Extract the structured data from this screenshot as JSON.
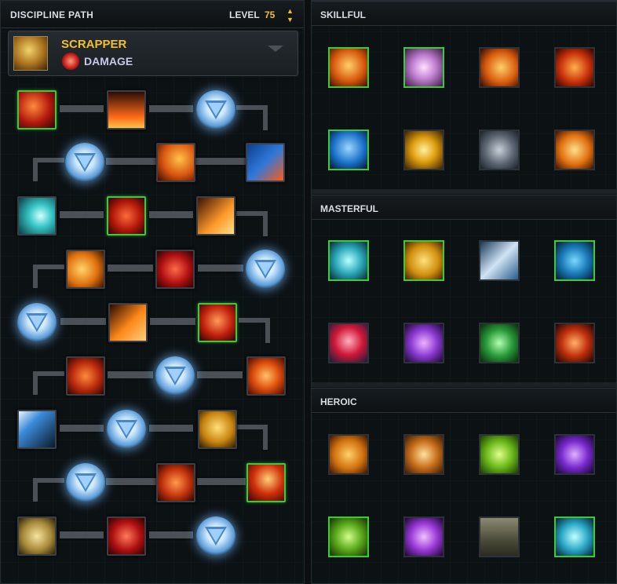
{
  "left": {
    "title": "DISCIPLINE PATH",
    "level_label": "LEVEL",
    "level_value": "75",
    "discipline": {
      "name": "SCRAPPER",
      "role": "DAMAGE"
    }
  },
  "right": {
    "sections": [
      {
        "title": "SKILLFUL"
      },
      {
        "title": "MASTERFUL"
      },
      {
        "title": "HEROIC"
      }
    ]
  },
  "colors": {
    "accent_gold": "#f2c02a",
    "selected_border": "#3ec93a",
    "utility_glow": "#5b9cd8"
  },
  "icons": {
    "level_up": "up-arrow",
    "level_down": "down-arrow",
    "dropdown": "chevron-down",
    "utility_slot": "downward-triangle"
  }
}
